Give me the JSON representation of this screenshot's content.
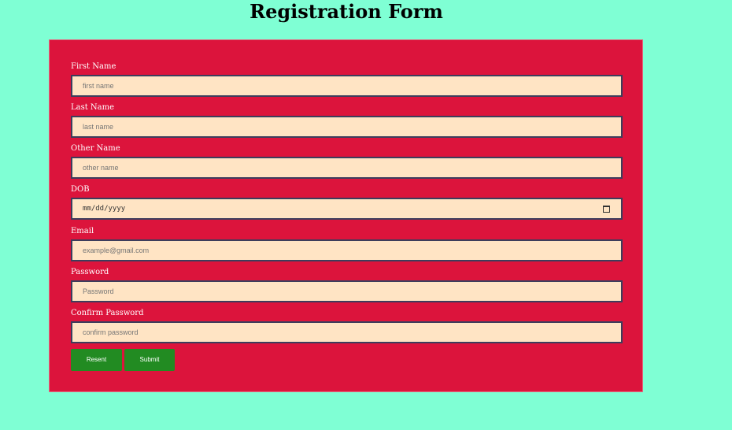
{
  "page": {
    "title": "Registration Form"
  },
  "form": {
    "fields": [
      {
        "label": "First Name",
        "placeholder": "first name"
      },
      {
        "label": "Last Name",
        "placeholder": "last name"
      },
      {
        "label": "Other Name",
        "placeholder": "other name"
      },
      {
        "label": "DOB",
        "value": "mm/dd/yyyy"
      },
      {
        "label": "Email",
        "placeholder": "example@gmail.com"
      },
      {
        "label": "Password",
        "placeholder": "Password"
      },
      {
        "label": "Confirm Password",
        "placeholder": "confirm password"
      }
    ],
    "buttons": {
      "reset_label": "Resent",
      "submit_label": "Submit"
    }
  },
  "colors": {
    "page_background": "#7fffd4",
    "form_background": "#dc143c",
    "input_background": "#ffe4c4",
    "button_background": "#228b22"
  },
  "icons": {
    "date_picker": "calendar-icon"
  }
}
